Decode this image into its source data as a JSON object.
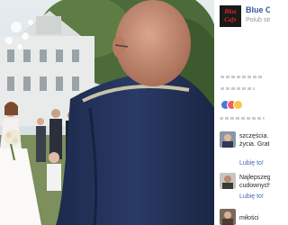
{
  "page": {
    "name": "Blue C",
    "meta": "Polub str",
    "logo_text": "Blue Cafe"
  },
  "reactions": {
    "count": "",
    "colors": {
      "like": "#4a76d8",
      "love": "#f0605e",
      "wow": "#f7c64a"
    }
  },
  "comments": [
    {
      "line1": "szczęścia.",
      "line2": "życia. Grat",
      "like": "Lubię to!"
    },
    {
      "line1": "Najlepszeg",
      "line2": "cudownych",
      "like": "Lubię to!"
    },
    {
      "line1": "miłości",
      "line2": "",
      "like": ""
    }
  ],
  "colors": {
    "link": "#365899",
    "muted": "#90949c",
    "like_link": "#4267b2"
  }
}
